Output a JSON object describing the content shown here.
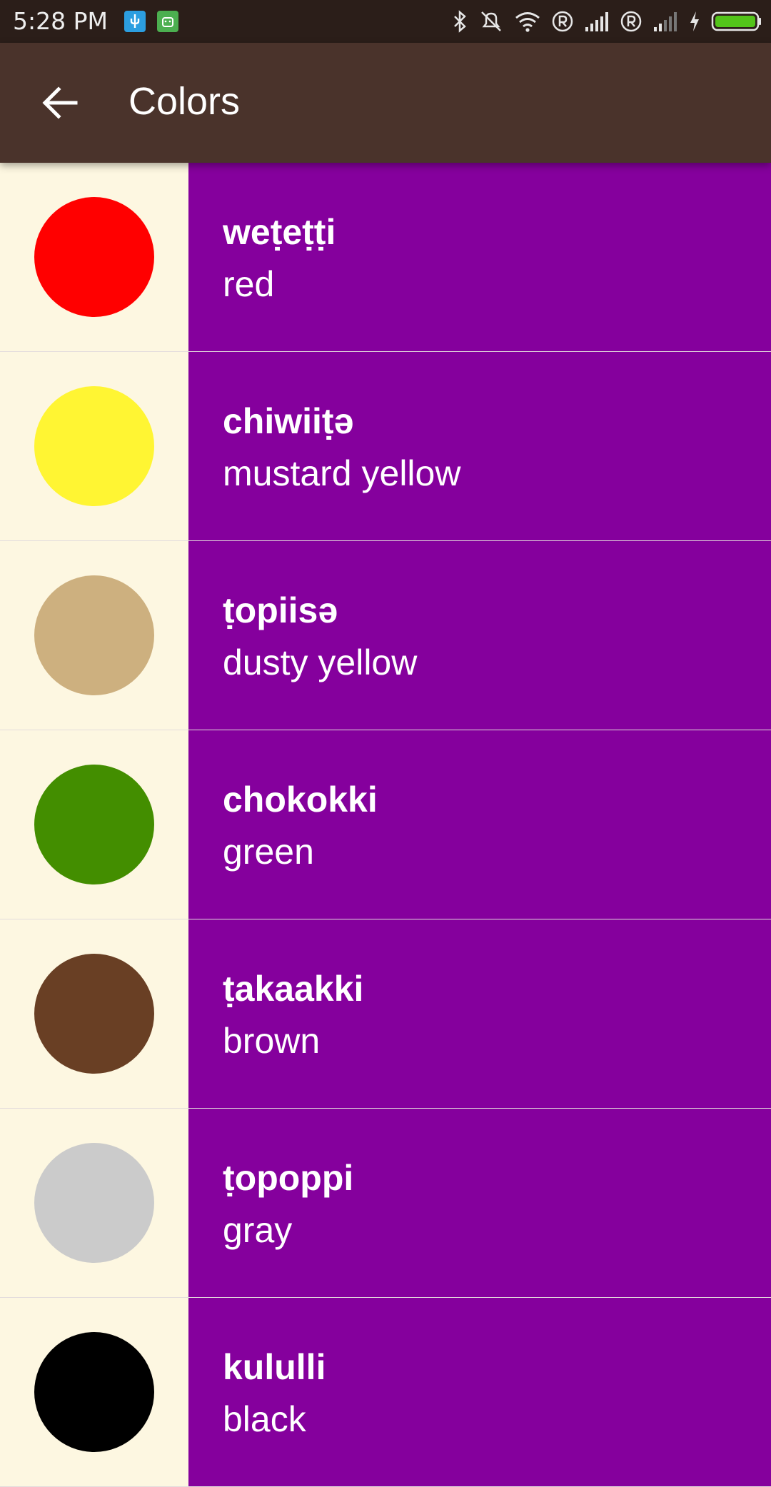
{
  "status_bar": {
    "time": "5:28 PM",
    "icons": [
      "usb-icon",
      "android-debug-icon",
      "bluetooth-icon",
      "alarm-off-icon",
      "wifi-icon",
      "roaming-r-icon",
      "signal-icon",
      "roaming-r-icon",
      "signal-weak-icon",
      "charging-icon",
      "battery-icon"
    ],
    "battery_color": "#53c41a"
  },
  "app_bar": {
    "title": "Colors",
    "back_icon": "arrow-left-icon",
    "background": "#4a332b"
  },
  "list": {
    "swatch_area_color": "#fdf7e1",
    "text_area_color": "#85009d",
    "items": [
      {
        "word": "weṭeṭṭi",
        "translation": "red",
        "color": "#ff0000"
      },
      {
        "word": "chiwiiṭə",
        "translation": "mustard yellow",
        "color": "#fff533"
      },
      {
        "word": "ṭopiisə",
        "translation": "dusty yellow",
        "color": "#cdb07f"
      },
      {
        "word": "chokokki",
        "translation": "green",
        "color": "#438e00"
      },
      {
        "word": "ṭakaakki",
        "translation": "brown",
        "color": "#693f24"
      },
      {
        "word": "ṭopoppi",
        "translation": "gray",
        "color": "#cbcbcb"
      },
      {
        "word": "kululli",
        "translation": "black",
        "color": "#000000"
      }
    ]
  }
}
